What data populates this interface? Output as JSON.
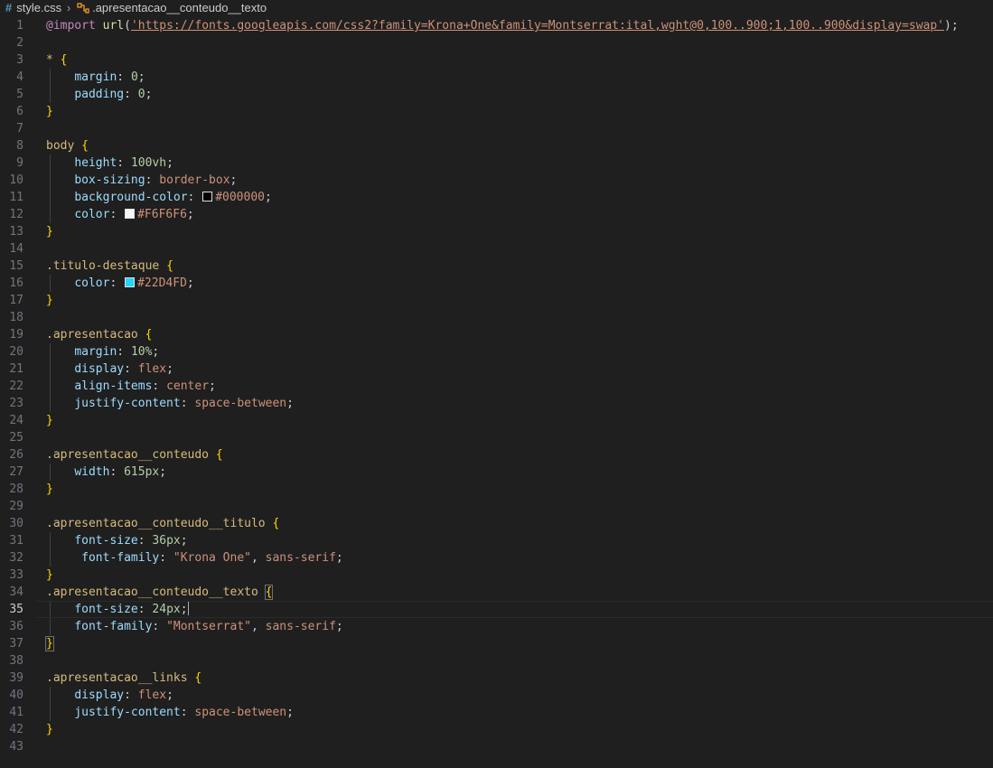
{
  "breadcrumb": {
    "file": "style.css",
    "symbol": ".apresentacao__conteudo__texto"
  },
  "colors": {
    "editor_bg": "#1f1f1f",
    "css_icon": "#519aba",
    "swatch_black": "#000000",
    "swatch_white": "#F6F6F6",
    "swatch_cyan": "#22D4FD"
  },
  "current_line": 35,
  "lines": [
    {
      "n": "1",
      "tokens": [
        {
          "c": "t-at",
          "t": "@import"
        },
        {
          "c": "t-punc",
          "t": " "
        },
        {
          "c": "t-fn",
          "t": "url"
        },
        {
          "c": "t-punc",
          "t": "("
        },
        {
          "c": "t-url",
          "t": "'https://fonts.googleapis.com/css2?family=Krona+One&family=Montserrat:ital,wght@0,100..900;1,100..900&display=swap'"
        },
        {
          "c": "t-punc",
          "t": ");"
        }
      ]
    },
    {
      "n": "2",
      "tokens": []
    },
    {
      "n": "3",
      "tokens": [
        {
          "c": "t-sel",
          "t": "*"
        },
        {
          "c": "t-punc",
          "t": " "
        },
        {
          "c": "t-brace",
          "t": "{"
        }
      ]
    },
    {
      "n": "4",
      "guide": true,
      "tokens": [
        {
          "c": "t-punc",
          "t": "    "
        },
        {
          "c": "t-prop",
          "t": "margin"
        },
        {
          "c": "t-punc",
          "t": ": "
        },
        {
          "c": "t-num",
          "t": "0"
        },
        {
          "c": "t-punc",
          "t": ";"
        }
      ]
    },
    {
      "n": "5",
      "guide": true,
      "tokens": [
        {
          "c": "t-punc",
          "t": "    "
        },
        {
          "c": "t-prop",
          "t": "padding"
        },
        {
          "c": "t-punc",
          "t": ": "
        },
        {
          "c": "t-num",
          "t": "0"
        },
        {
          "c": "t-punc",
          "t": ";"
        }
      ]
    },
    {
      "n": "6",
      "tokens": [
        {
          "c": "t-brace",
          "t": "}"
        }
      ]
    },
    {
      "n": "7",
      "tokens": []
    },
    {
      "n": "8",
      "tokens": [
        {
          "c": "t-tag",
          "t": "body"
        },
        {
          "c": "t-punc",
          "t": " "
        },
        {
          "c": "t-brace",
          "t": "{"
        }
      ]
    },
    {
      "n": "9",
      "guide": true,
      "tokens": [
        {
          "c": "t-punc",
          "t": "    "
        },
        {
          "c": "t-prop",
          "t": "height"
        },
        {
          "c": "t-punc",
          "t": ": "
        },
        {
          "c": "t-num",
          "t": "100vh"
        },
        {
          "c": "t-punc",
          "t": ";"
        }
      ]
    },
    {
      "n": "10",
      "guide": true,
      "tokens": [
        {
          "c": "t-punc",
          "t": "    "
        },
        {
          "c": "t-prop",
          "t": "box-sizing"
        },
        {
          "c": "t-punc",
          "t": ": "
        },
        {
          "c": "t-val",
          "t": "border-box"
        },
        {
          "c": "t-punc",
          "t": ";"
        }
      ]
    },
    {
      "n": "11",
      "guide": true,
      "tokens": [
        {
          "c": "t-punc",
          "t": "    "
        },
        {
          "c": "t-prop",
          "t": "background-color"
        },
        {
          "c": "t-punc",
          "t": ": "
        },
        {
          "c": "swatch",
          "color": "#000000"
        },
        {
          "c": "t-val",
          "t": "#000000"
        },
        {
          "c": "t-punc",
          "t": ";"
        }
      ]
    },
    {
      "n": "12",
      "guide": true,
      "tokens": [
        {
          "c": "t-punc",
          "t": "    "
        },
        {
          "c": "t-prop",
          "t": "color"
        },
        {
          "c": "t-punc",
          "t": ": "
        },
        {
          "c": "swatch",
          "color": "#F6F6F6"
        },
        {
          "c": "t-val",
          "t": "#F6F6F6"
        },
        {
          "c": "t-punc",
          "t": ";"
        }
      ]
    },
    {
      "n": "13",
      "tokens": [
        {
          "c": "t-brace",
          "t": "}"
        }
      ]
    },
    {
      "n": "14",
      "tokens": []
    },
    {
      "n": "15",
      "tokens": [
        {
          "c": "t-sel",
          "t": ".titulo-destaque"
        },
        {
          "c": "t-punc",
          "t": " "
        },
        {
          "c": "t-brace",
          "t": "{"
        }
      ]
    },
    {
      "n": "16",
      "guide": true,
      "tokens": [
        {
          "c": "t-punc",
          "t": "    "
        },
        {
          "c": "t-prop",
          "t": "color"
        },
        {
          "c": "t-punc",
          "t": ": "
        },
        {
          "c": "swatch",
          "color": "#22D4FD"
        },
        {
          "c": "t-val",
          "t": "#22D4FD"
        },
        {
          "c": "t-punc",
          "t": ";"
        }
      ]
    },
    {
      "n": "17",
      "tokens": [
        {
          "c": "t-brace",
          "t": "}"
        }
      ]
    },
    {
      "n": "18",
      "tokens": []
    },
    {
      "n": "19",
      "tokens": [
        {
          "c": "t-sel",
          "t": ".apresentacao"
        },
        {
          "c": "t-punc",
          "t": " "
        },
        {
          "c": "t-brace",
          "t": "{"
        }
      ]
    },
    {
      "n": "20",
      "guide": true,
      "tokens": [
        {
          "c": "t-punc",
          "t": "    "
        },
        {
          "c": "t-prop",
          "t": "margin"
        },
        {
          "c": "t-punc",
          "t": ": "
        },
        {
          "c": "t-num",
          "t": "10%"
        },
        {
          "c": "t-punc",
          "t": ";"
        }
      ]
    },
    {
      "n": "21",
      "guide": true,
      "tokens": [
        {
          "c": "t-punc",
          "t": "    "
        },
        {
          "c": "t-prop",
          "t": "display"
        },
        {
          "c": "t-punc",
          "t": ": "
        },
        {
          "c": "t-val",
          "t": "flex"
        },
        {
          "c": "t-punc",
          "t": ";"
        }
      ]
    },
    {
      "n": "22",
      "guide": true,
      "tokens": [
        {
          "c": "t-punc",
          "t": "    "
        },
        {
          "c": "t-prop",
          "t": "align-items"
        },
        {
          "c": "t-punc",
          "t": ": "
        },
        {
          "c": "t-val",
          "t": "center"
        },
        {
          "c": "t-punc",
          "t": ";"
        }
      ]
    },
    {
      "n": "23",
      "guide": true,
      "tokens": [
        {
          "c": "t-punc",
          "t": "    "
        },
        {
          "c": "t-prop",
          "t": "justify-content"
        },
        {
          "c": "t-punc",
          "t": ": "
        },
        {
          "c": "t-val",
          "t": "space-between"
        },
        {
          "c": "t-punc",
          "t": ";"
        }
      ]
    },
    {
      "n": "24",
      "tokens": [
        {
          "c": "t-brace",
          "t": "}"
        }
      ]
    },
    {
      "n": "25",
      "tokens": []
    },
    {
      "n": "26",
      "tokens": [
        {
          "c": "t-sel",
          "t": ".apresentacao__conteudo"
        },
        {
          "c": "t-punc",
          "t": " "
        },
        {
          "c": "t-brace",
          "t": "{"
        }
      ]
    },
    {
      "n": "27",
      "guide": true,
      "tokens": [
        {
          "c": "t-punc",
          "t": "    "
        },
        {
          "c": "t-prop",
          "t": "width"
        },
        {
          "c": "t-punc",
          "t": ": "
        },
        {
          "c": "t-num",
          "t": "615px"
        },
        {
          "c": "t-punc",
          "t": ";"
        }
      ]
    },
    {
      "n": "28",
      "tokens": [
        {
          "c": "t-brace",
          "t": "}"
        }
      ]
    },
    {
      "n": "29",
      "tokens": []
    },
    {
      "n": "30",
      "tokens": [
        {
          "c": "t-sel",
          "t": ".apresentacao__conteudo__titulo"
        },
        {
          "c": "t-punc",
          "t": " "
        },
        {
          "c": "t-brace",
          "t": "{"
        }
      ]
    },
    {
      "n": "31",
      "guide": true,
      "tokens": [
        {
          "c": "t-punc",
          "t": "    "
        },
        {
          "c": "t-prop",
          "t": "font-size"
        },
        {
          "c": "t-punc",
          "t": ": "
        },
        {
          "c": "t-num",
          "t": "36px"
        },
        {
          "c": "t-punc",
          "t": ";"
        }
      ]
    },
    {
      "n": "32",
      "guide": true,
      "tokens": [
        {
          "c": "t-punc",
          "t": "     "
        },
        {
          "c": "t-prop",
          "t": "font-family"
        },
        {
          "c": "t-punc",
          "t": ": "
        },
        {
          "c": "t-str",
          "t": "\"Krona One\""
        },
        {
          "c": "t-punc",
          "t": ", "
        },
        {
          "c": "t-val",
          "t": "sans-serif"
        },
        {
          "c": "t-punc",
          "t": ";"
        }
      ]
    },
    {
      "n": "33",
      "tokens": [
        {
          "c": "t-brace",
          "t": "}"
        }
      ]
    },
    {
      "n": "34",
      "tokens": [
        {
          "c": "t-sel",
          "t": ".apresentacao__conteudo__texto"
        },
        {
          "c": "t-punc",
          "t": " "
        },
        {
          "c": "t-brace-hl",
          "t": "{"
        }
      ]
    },
    {
      "n": "35",
      "guide": true,
      "tokens": [
        {
          "c": "t-punc",
          "t": "    "
        },
        {
          "c": "t-prop",
          "t": "font-size"
        },
        {
          "c": "t-punc",
          "t": ": "
        },
        {
          "c": "t-num",
          "t": "24px"
        },
        {
          "c": "t-punc",
          "t": ";"
        },
        {
          "c": "cursor"
        }
      ]
    },
    {
      "n": "36",
      "guide": true,
      "tokens": [
        {
          "c": "t-punc",
          "t": "    "
        },
        {
          "c": "t-prop",
          "t": "font-family"
        },
        {
          "c": "t-punc",
          "t": ": "
        },
        {
          "c": "t-str",
          "t": "\"Montserrat\""
        },
        {
          "c": "t-punc",
          "t": ", "
        },
        {
          "c": "t-val",
          "t": "sans-serif"
        },
        {
          "c": "t-punc",
          "t": ";"
        }
      ]
    },
    {
      "n": "37",
      "tokens": [
        {
          "c": "t-brace-hl",
          "t": "}"
        }
      ]
    },
    {
      "n": "38",
      "tokens": []
    },
    {
      "n": "39",
      "tokens": [
        {
          "c": "t-sel",
          "t": ".apresentacao__links"
        },
        {
          "c": "t-punc",
          "t": " "
        },
        {
          "c": "t-brace",
          "t": "{"
        }
      ]
    },
    {
      "n": "40",
      "guide": true,
      "tokens": [
        {
          "c": "t-punc",
          "t": "    "
        },
        {
          "c": "t-prop",
          "t": "display"
        },
        {
          "c": "t-punc",
          "t": ": "
        },
        {
          "c": "t-val",
          "t": "flex"
        },
        {
          "c": "t-punc",
          "t": ";"
        }
      ]
    },
    {
      "n": "41",
      "guide": true,
      "tokens": [
        {
          "c": "t-punc",
          "t": "    "
        },
        {
          "c": "t-prop",
          "t": "justify-content"
        },
        {
          "c": "t-punc",
          "t": ": "
        },
        {
          "c": "t-val",
          "t": "space-between"
        },
        {
          "c": "t-punc",
          "t": ";"
        }
      ]
    },
    {
      "n": "42",
      "tokens": [
        {
          "c": "t-brace",
          "t": "}"
        }
      ]
    },
    {
      "n": "43",
      "tokens": []
    }
  ]
}
